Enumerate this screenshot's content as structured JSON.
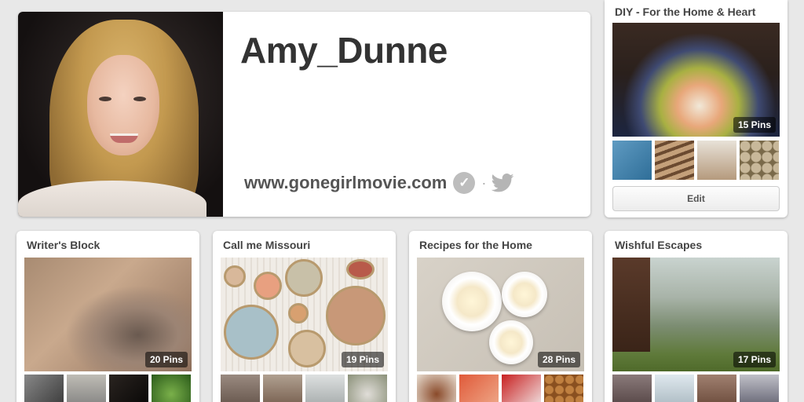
{
  "profile": {
    "name": "Amy_Dunne",
    "website": "www.gonegirlmovie.com",
    "verified_icon": "checkmark-icon",
    "social_icon": "twitter-icon"
  },
  "top_board": {
    "title": "DIY - For the Home & Heart",
    "pins": "15 Pins",
    "edit_label": "Edit"
  },
  "boards": [
    {
      "title": "Writer's Block",
      "pins": "20 Pins"
    },
    {
      "title": "Call me Missouri",
      "pins": "19 Pins"
    },
    {
      "title": "Recipes for the Home",
      "pins": "28 Pins"
    },
    {
      "title": "Wishful Escapes",
      "pins": "17 Pins"
    }
  ],
  "colors": {
    "background": "#e8e8e8",
    "badge": "#000000",
    "text_dark": "#333333"
  }
}
